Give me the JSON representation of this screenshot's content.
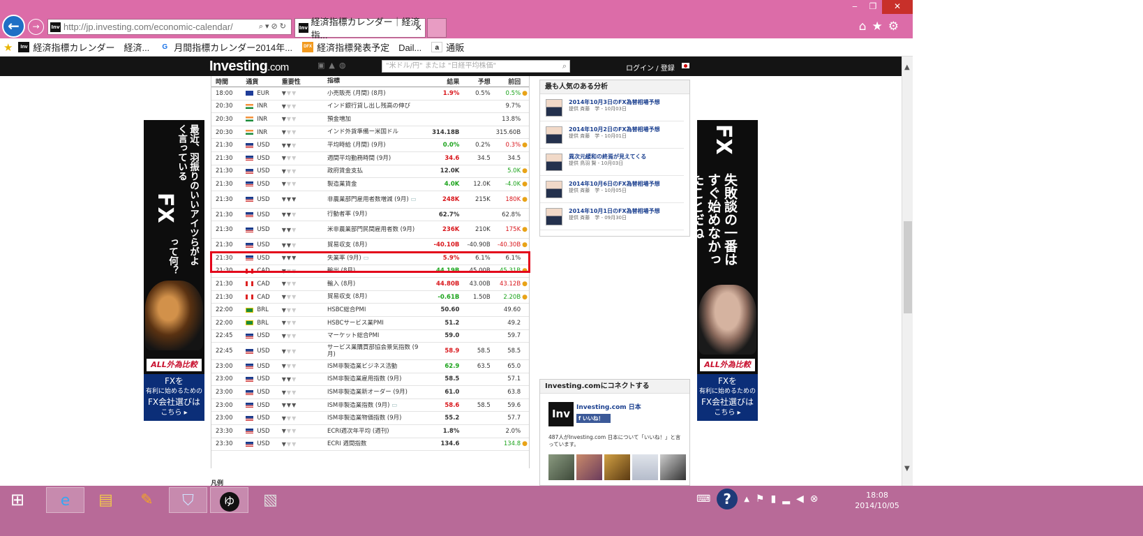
{
  "browser": {
    "url": "http://jp.investing.com/economic-calendar/",
    "tab_title": "経済指標カレンダー｜経済指...",
    "tab_favicon": "Inv",
    "favorites": [
      {
        "icon": "Inv",
        "label": "経済指標カレンダー　経済..."
      },
      {
        "icon": "G",
        "label": "月間指標カレンダー2014年..."
      },
      {
        "icon": "DFX",
        "label": "経済指標発表予定　Dail..."
      },
      {
        "icon": "a",
        "label": "通販"
      }
    ],
    "window_controls": {
      "minimize": "‒",
      "maximize": "❐",
      "close": "✕"
    }
  },
  "site": {
    "logo_main": "Investing",
    "logo_suffix": ".com",
    "search_placeholder": "\"米ドル/円\" または \"日経平均株価\"",
    "login_label": "ログイン / 登録"
  },
  "calendar": {
    "headers": {
      "time": "時間",
      "currency": "通貨",
      "importance": "重要性",
      "event": "指標",
      "actual": "結果",
      "forecast": "予想",
      "previous": "前回"
    },
    "rows": [
      {
        "time": "18:00",
        "cur": "EUR",
        "imp": 1,
        "event": "小売販売 (月間) (8月)",
        "act": "1.9%",
        "fc": "0.5%",
        "prev": "0.5%",
        "act_color": "neg",
        "prev_color": "pos",
        "dot": true
      },
      {
        "time": "20:30",
        "cur": "INR",
        "imp": 1,
        "event": "インド銀行貸し出し残高の伸び",
        "act": "",
        "fc": "",
        "prev": "9.7%",
        "act_color": "",
        "prev_color": "",
        "dot": false
      },
      {
        "time": "20:30",
        "cur": "INR",
        "imp": 1,
        "event": "預金増加",
        "act": "",
        "fc": "",
        "prev": "13.8%",
        "act_color": "",
        "prev_color": "",
        "dot": false
      },
      {
        "time": "20:30",
        "cur": "INR",
        "imp": 1,
        "event": "インド外貨準備ー米国ドル",
        "act": "314.18B",
        "fc": "",
        "prev": "315.60B",
        "act_color": "",
        "prev_color": "",
        "dot": false
      },
      {
        "time": "21:30",
        "cur": "USD",
        "imp": 2,
        "event": "平均時給 (月間) (9月)",
        "act": "0.0%",
        "fc": "0.2%",
        "prev": "0.3%",
        "act_color": "pos",
        "prev_color": "neg",
        "dot": true
      },
      {
        "time": "21:30",
        "cur": "USD",
        "imp": 1,
        "event": "週間平均勤務時間 (9月)",
        "act": "34.6",
        "fc": "34.5",
        "prev": "34.5",
        "act_color": "neg",
        "prev_color": "",
        "dot": false
      },
      {
        "time": "21:30",
        "cur": "USD",
        "imp": 1,
        "event": "政府賃金支払",
        "act": "12.0K",
        "fc": "",
        "prev": "5.0K",
        "act_color": "",
        "prev_color": "pos",
        "dot": true
      },
      {
        "time": "21:30",
        "cur": "USD",
        "imp": 1,
        "event": "製造業賃金",
        "act": "4.0K",
        "fc": "12.0K",
        "prev": "-4.0K",
        "act_color": "pos",
        "prev_color": "pos",
        "dot": true
      },
      {
        "time": "21:30",
        "cur": "USD",
        "imp": 3,
        "event": "非農業部門雇用者数増減 (9月)",
        "act": "248K",
        "fc": "215K",
        "prev": "180K",
        "act_color": "neg",
        "prev_color": "neg",
        "dot": true,
        "tall": true,
        "comment": true
      },
      {
        "time": "21:30",
        "cur": "USD",
        "imp": 2,
        "event": "行動者率 (9月)",
        "act": "62.7%",
        "fc": "",
        "prev": "62.8%",
        "act_color": "",
        "prev_color": "",
        "dot": false
      },
      {
        "time": "21:30",
        "cur": "USD",
        "imp": 2,
        "event": "米非農業部門民間雇用者数 (9月)",
        "act": "236K",
        "fc": "210K",
        "prev": "175K",
        "act_color": "neg",
        "prev_color": "neg",
        "dot": true,
        "tall": true
      },
      {
        "time": "21:30",
        "cur": "USD",
        "imp": 2,
        "event": "貿易収支 (8月)",
        "act": "-40.10B",
        "fc": "-40.90B",
        "prev": "-40.30B",
        "act_color": "neg",
        "prev_color": "neg",
        "dot": true
      },
      {
        "time": "21:30",
        "cur": "USD",
        "imp": 3,
        "event": "失業率 (9月)",
        "act": "5.9%",
        "fc": "6.1%",
        "prev": "6.1%",
        "act_color": "neg",
        "prev_color": "",
        "dot": false,
        "comment": true
      },
      {
        "time": "21:30",
        "cur": "CAD",
        "imp": 1,
        "event": "輸出 (8月)",
        "act": "44.19B",
        "fc": "45.00B",
        "prev": "45.31B",
        "act_color": "pos",
        "prev_color": "pos",
        "dot": true
      },
      {
        "time": "21:30",
        "cur": "CAD",
        "imp": 1,
        "event": "輸入 (8月)",
        "act": "44.80B",
        "fc": "43.00B",
        "prev": "43.12B",
        "act_color": "neg",
        "prev_color": "neg",
        "dot": true
      },
      {
        "time": "21:30",
        "cur": "CAD",
        "imp": 1,
        "event": "貿易収支 (8月)",
        "act": "-0.61B",
        "fc": "1.50B",
        "prev": "2.20B",
        "act_color": "pos",
        "prev_color": "pos",
        "dot": true
      },
      {
        "time": "22:00",
        "cur": "BRL",
        "imp": 1,
        "event": "HSBC総合PMI",
        "act": "50.60",
        "fc": "",
        "prev": "49.60",
        "act_color": "",
        "prev_color": "",
        "dot": false
      },
      {
        "time": "22:00",
        "cur": "BRL",
        "imp": 1,
        "event": "HSBCサービス業PMI",
        "act": "51.2",
        "fc": "",
        "prev": "49.2",
        "act_color": "",
        "prev_color": "",
        "dot": false
      },
      {
        "time": "22:45",
        "cur": "USD",
        "imp": 1,
        "event": "マーケット総合PMI",
        "act": "59.0",
        "fc": "",
        "prev": "59.7",
        "act_color": "",
        "prev_color": "",
        "dot": false
      },
      {
        "time": "22:45",
        "cur": "USD",
        "imp": 1,
        "event": "サービス業購買部協会景気指数 (9月)",
        "act": "58.9",
        "fc": "58.5",
        "prev": "58.5",
        "act_color": "neg",
        "prev_color": "",
        "dot": false,
        "tall": true
      },
      {
        "time": "23:00",
        "cur": "USD",
        "imp": 1,
        "event": "ISM非製造業ビジネス活動",
        "act": "62.9",
        "fc": "63.5",
        "prev": "65.0",
        "act_color": "pos",
        "prev_color": "",
        "dot": false
      },
      {
        "time": "23:00",
        "cur": "USD",
        "imp": 2,
        "event": "ISM非製造業雇用指数 (9月)",
        "act": "58.5",
        "fc": "",
        "prev": "57.1",
        "act_color": "",
        "prev_color": "",
        "dot": false
      },
      {
        "time": "23:00",
        "cur": "USD",
        "imp": 1,
        "event": "ISM非製造業新オーダー (9月)",
        "act": "61.0",
        "fc": "",
        "prev": "63.8",
        "act_color": "",
        "prev_color": "",
        "dot": false
      },
      {
        "time": "23:00",
        "cur": "USD",
        "imp": 3,
        "event": "ISM非製造業指数 (9月)",
        "act": "58.6",
        "fc": "58.5",
        "prev": "59.6",
        "act_color": "neg",
        "prev_color": "",
        "dot": false,
        "comment": true
      },
      {
        "time": "23:00",
        "cur": "USD",
        "imp": 1,
        "event": "ISM非製造業物価指数 (9月)",
        "act": "55.2",
        "fc": "",
        "prev": "57.7",
        "act_color": "",
        "prev_color": "",
        "dot": false
      },
      {
        "time": "23:30",
        "cur": "USD",
        "imp": 1,
        "event": "ECRI週次年平均 (週刊)",
        "act": "1.8%",
        "fc": "",
        "prev": "2.0%",
        "act_color": "",
        "prev_color": "",
        "dot": false
      },
      {
        "time": "23:30",
        "cur": "USD",
        "imp": 1,
        "event": "ECRI 週間指数",
        "act": "134.6",
        "fc": "",
        "prev": "134.8",
        "act_color": "",
        "prev_color": "pos",
        "dot": true
      }
    ],
    "legend_label": "凡例"
  },
  "popular": {
    "title": "最も人気のある分析",
    "articles": [
      {
        "title": "2014年10月3日のFX為替相場予想",
        "meta": "提供 斉藤　学 - 10月03日"
      },
      {
        "title": "2014年10月2日のFX為替相場予想",
        "meta": "提供 斉藤　学 - 10月01日"
      },
      {
        "title": "異次元緩和の終焉が見えてくる",
        "meta": "提供 鳥羽 賢 - 10月03日"
      },
      {
        "title": "2014年10月6日のFX為替相場予想",
        "meta": "提供 斉藤　学 - 10月05日"
      },
      {
        "title": "2014年10月1日のFX為替相場予想",
        "meta": "提供 斉藤　学 - 09月30日"
      }
    ]
  },
  "connect": {
    "title": "Investing.comにコネクトする",
    "logo": "Inv",
    "page_name": "Investing.com 日本",
    "like_label": "いいね！",
    "count_text": "487人がInvesting.com 日本について「いいね！」と言っています。"
  },
  "ads": {
    "left_text": "最近、羽振りのいいアイツらがよく言っている",
    "left_fx": "FX",
    "left_tail": "って何？",
    "right_fx": "FX",
    "right_text": "失敗談の一番はすぐ始めなかったことだね",
    "brand": "ALL外為比較",
    "foot_line1": "FXを",
    "foot_line2": "有利に始めるための",
    "foot_line3": "FX会社選びは",
    "foot_line4": "こちら ▸"
  },
  "taskbar": {
    "time": "18:08",
    "date": "2014/10/05"
  }
}
